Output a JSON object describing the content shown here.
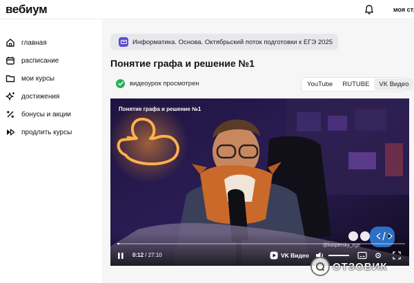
{
  "header": {
    "logo": "вебиум",
    "profile_label": "моя стр"
  },
  "sidebar": {
    "items": [
      {
        "label": "главная",
        "icon": "home-icon"
      },
      {
        "label": "расписание",
        "icon": "calendar-icon"
      },
      {
        "label": "мои курсы",
        "icon": "folder-icon"
      },
      {
        "label": "достижения",
        "icon": "sparkle-icon"
      },
      {
        "label": "бонусы и акции",
        "icon": "percent-icon"
      },
      {
        "label": "продлить курсы",
        "icon": "forward-icon"
      }
    ]
  },
  "course": {
    "breadcrumb": "Информатика. Основа. Октябрьский поток подготовки к ЕГЭ 2025"
  },
  "lesson": {
    "title": "Понятие графа и решение №1",
    "status": "видеоурок просмотрен"
  },
  "tabs": [
    {
      "label": "YouTube",
      "active": false
    },
    {
      "label": "RUTUBE",
      "active": false
    },
    {
      "label": "VK Видео",
      "active": true
    }
  ],
  "player": {
    "video_title": "Понятие графа и решение №1",
    "current_time": "0:12",
    "duration": "/ 27:10",
    "progress": 0.0074,
    "brand": "VK Видео",
    "watermark": "@kaspersky_ege"
  },
  "overlay": {
    "text": "ОТЗОВИК"
  },
  "colors": {
    "accent": "#5b4bd6",
    "success": "#2cae5a"
  }
}
